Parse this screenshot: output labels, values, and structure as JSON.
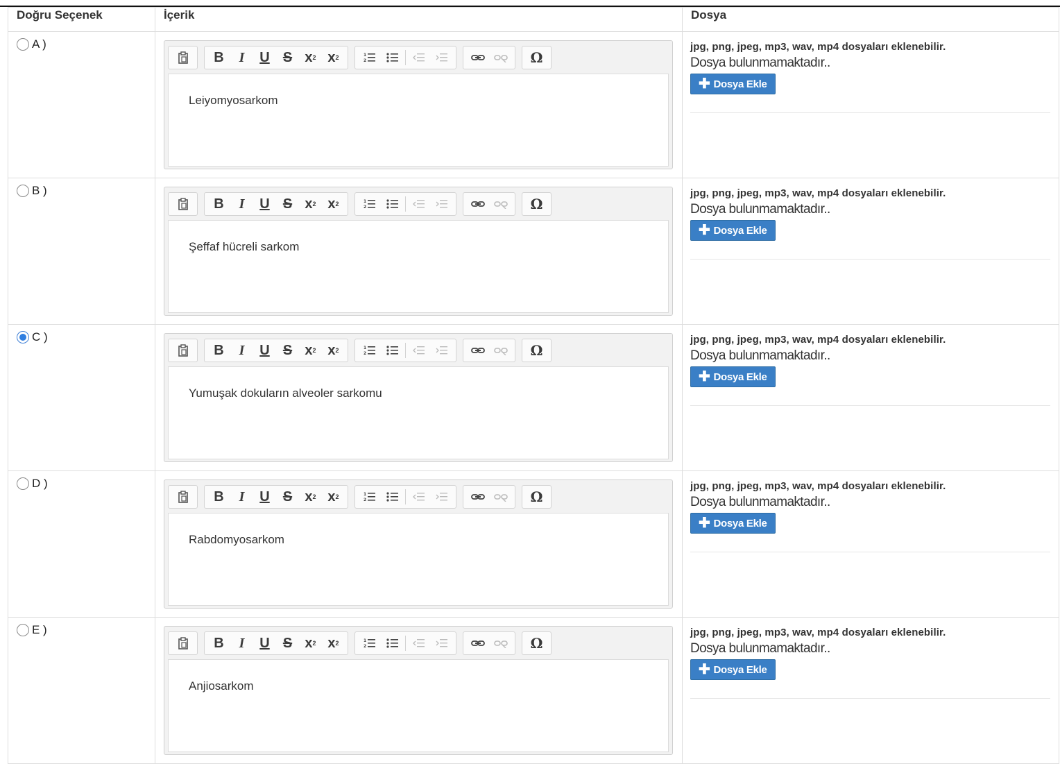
{
  "headers": {
    "correct": "Doğru Seçenek",
    "content": "İçerik",
    "file": "Dosya"
  },
  "file_section": {
    "hint": "jpg, png, jpeg, mp3, wav, mp4 dosyaları eklenebilir.",
    "empty": "Dosya bulunmamaktadır..",
    "add_label": "Dosya Ekle"
  },
  "toolbar": {
    "bold": "B",
    "italic": "I",
    "underline": "U",
    "strike": "S",
    "subscript": "x",
    "superscript": "x",
    "omega": "Ω"
  },
  "options": [
    {
      "label": "A )",
      "content": "Leiyomyosarkom",
      "selected": false
    },
    {
      "label": "B )",
      "content": "Şeffaf hücreli sarkom",
      "selected": false
    },
    {
      "label": "C )",
      "content": "Yumuşak dokuların alveoler sarkomu",
      "selected": true
    },
    {
      "label": "D )",
      "content": "Rabdomyosarkom",
      "selected": false
    },
    {
      "label": "E )",
      "content": "Anjiosarkom",
      "selected": false
    }
  ],
  "colors": {
    "accent": "#2f7ee0",
    "button": "#3a7fc6"
  }
}
